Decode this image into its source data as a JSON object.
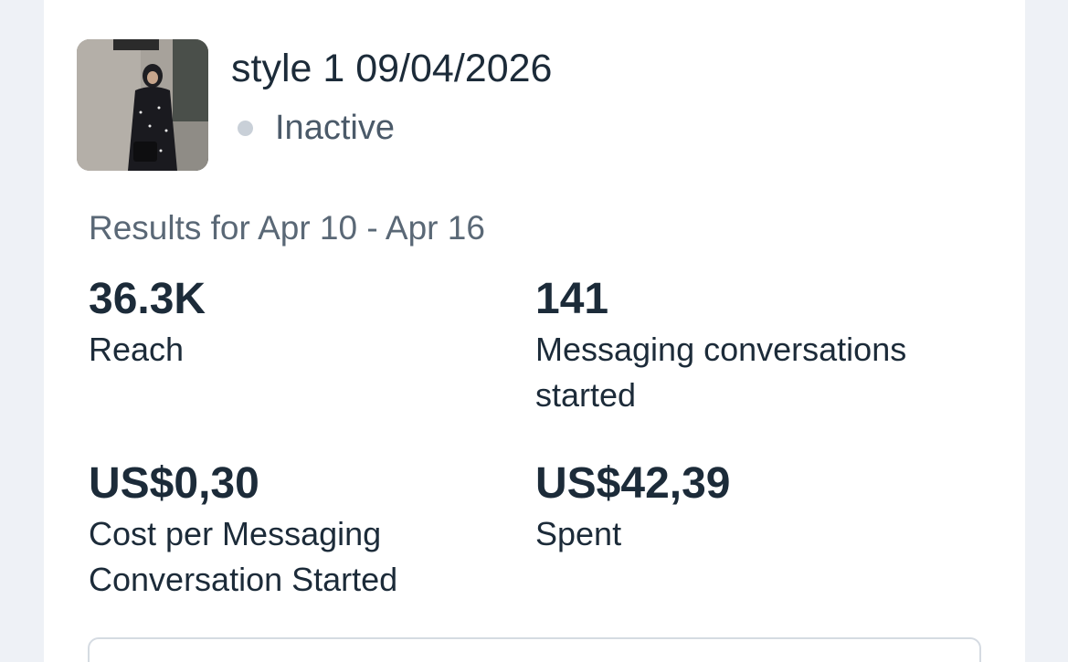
{
  "ad": {
    "title": "style 1 09/04/2026",
    "status": "Inactive"
  },
  "results": {
    "title": "Results for Apr 10 - Apr 16",
    "metrics": [
      {
        "value": "36.3K",
        "label": "Reach"
      },
      {
        "value": "141",
        "label": "Messaging conversations started"
      },
      {
        "value": "US$0,30",
        "label": "Cost per Messaging Conversation Started"
      },
      {
        "value": "US$42,39",
        "label": "Spent"
      }
    ]
  },
  "colors": {
    "text_primary": "#1c2b39",
    "text_secondary": "#5a6876",
    "status_inactive": "#c9d0d8",
    "background": "#eef1f6"
  }
}
